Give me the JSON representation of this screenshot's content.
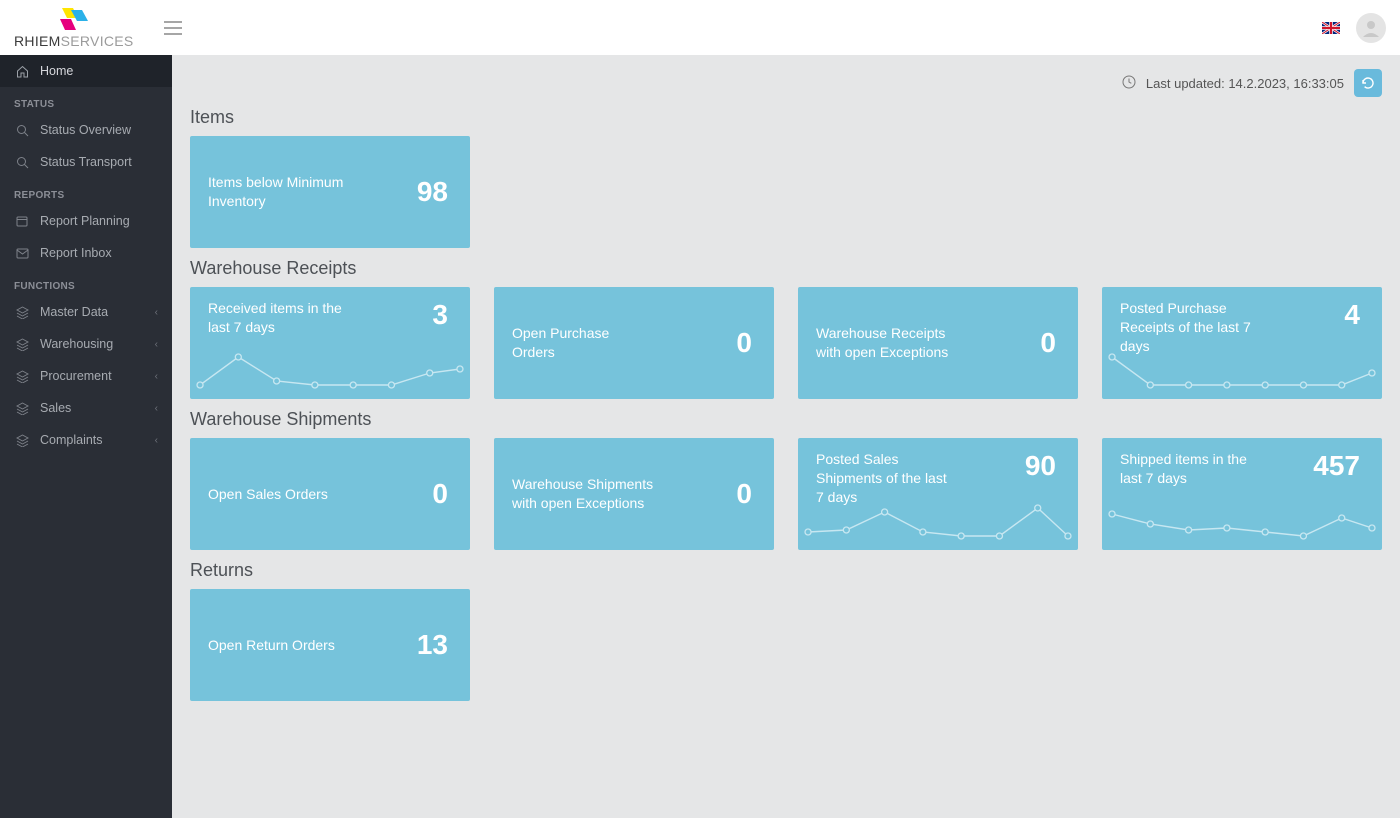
{
  "brand": {
    "name_bold": "RHIEM",
    "name_light": "SERVICES"
  },
  "header": {
    "last_updated_prefix": "Last updated:",
    "last_updated_value": "14.2.2023, 16:33:05"
  },
  "sidebar": {
    "home": "Home",
    "section_status": "STATUS",
    "status_overview": "Status Overview",
    "status_transport": "Status Transport",
    "section_reports": "REPORTS",
    "report_planning": "Report Planning",
    "report_inbox": "Report Inbox",
    "section_functions": "FUNCTIONS",
    "master_data": "Master Data",
    "warehousing": "Warehousing",
    "procurement": "Procurement",
    "sales": "Sales",
    "complaints": "Complaints"
  },
  "sections": {
    "items": "Items",
    "warehouse_receipts": "Warehouse Receipts",
    "warehouse_shipments": "Warehouse Shipments",
    "returns": "Returns"
  },
  "cards": {
    "items_below_min": {
      "label": "Items below Minimum Inventory",
      "value": "98"
    },
    "received_items_7d": {
      "label": "Received items in the last 7 days",
      "value": "3"
    },
    "open_purchase_orders": {
      "label": "Open Purchase Orders",
      "value": "0"
    },
    "receipts_open_exceptions": {
      "label": "Warehouse Receipts with open Exceptions",
      "value": "0"
    },
    "posted_purchase_7d": {
      "label": "Posted Purchase Receipts of the last 7 days",
      "value": "4"
    },
    "open_sales_orders": {
      "label": "Open Sales Orders",
      "value": "0"
    },
    "shipments_open_exceptions": {
      "label": "Warehouse Shipments with open Exceptions",
      "value": "0"
    },
    "posted_sales_7d": {
      "label": "Posted Sales Shipments of the last 7 days",
      "value": "90"
    },
    "shipped_items_7d": {
      "label": "Shipped items in the last 7 days",
      "value": "457"
    },
    "open_return_orders": {
      "label": "Open Return Orders",
      "value": "13"
    }
  }
}
